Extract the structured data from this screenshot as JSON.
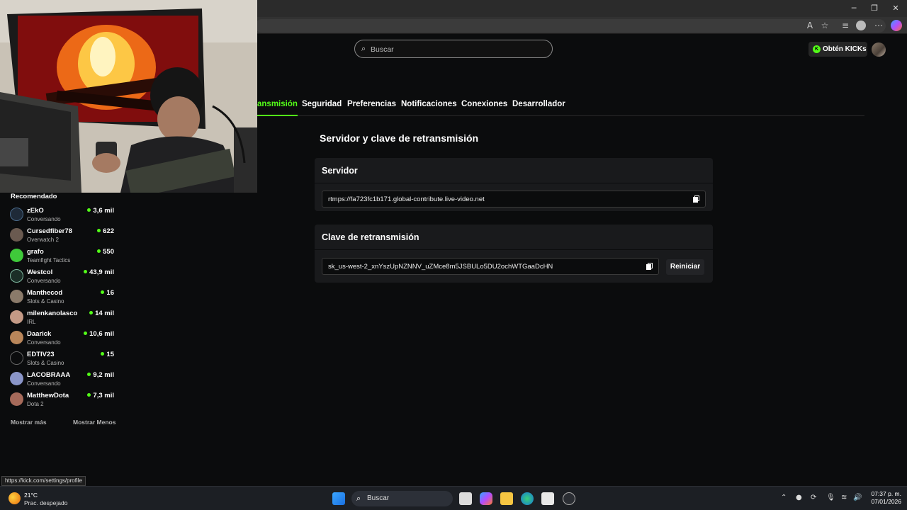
{
  "browser": {
    "minimize": "─",
    "maximize": "❐",
    "close": "✕"
  },
  "header": {
    "search_placeholder": "Buscar",
    "kicks_button": "Obtén KICKs"
  },
  "tabs": [
    {
      "label": "ansmisión",
      "active": true
    },
    {
      "label": "Seguridad"
    },
    {
      "label": "Preferencias"
    },
    {
      "label": "Notificaciones"
    },
    {
      "label": "Conexiones"
    },
    {
      "label": "Desarrollador"
    }
  ],
  "main": {
    "section_title": "Servidor y clave de retransmisión",
    "server_card": {
      "title": "Servidor",
      "value": "rtmps://fa723fc1b171.global-contribute.live-video.net"
    },
    "key_card": {
      "title": "Clave de retransmisión",
      "value": "sk_us-west-2_xnYszUpNZNNV_uZMce8m5JSBULo5DU2ochWTGaaDcHN",
      "reset_label": "Reiniciar"
    }
  },
  "sidebar": {
    "title": "Recomendado",
    "items": [
      {
        "name": "zEkO",
        "category": "Conversando",
        "viewers": "3,6 mil"
      },
      {
        "name": "Cursedfiber78",
        "category": "Overwatch 2",
        "viewers": "622"
      },
      {
        "name": "grafo",
        "category": "Teamfight Tactics",
        "viewers": "550"
      },
      {
        "name": "Westcol",
        "category": "Conversando",
        "viewers": "43,9 mil"
      },
      {
        "name": "Manthecod",
        "category": "Slots & Casino",
        "viewers": "16"
      },
      {
        "name": "milenkanolasco",
        "category": "IRL",
        "viewers": "14 mil"
      },
      {
        "name": "Daarick",
        "category": "Conversando",
        "viewers": "10,6 mil"
      },
      {
        "name": "EDTIV23",
        "category": "Slots & Casino",
        "viewers": "15"
      },
      {
        "name": "LACOBRAAA",
        "category": "Conversando",
        "viewers": "9,2 mil"
      },
      {
        "name": "MatthewDota",
        "category": "Dota 2",
        "viewers": "7,3 mil"
      }
    ],
    "show_more": "Mostrar más",
    "show_less": "Mostrar Menos"
  },
  "status_url": "https://kick.com/settings/profile",
  "taskbar": {
    "temperature": "21°C",
    "weather": "Prac. despejado",
    "search_label": "Buscar",
    "time": "07:37 p. m.",
    "date": "07/01/2026"
  },
  "colors": {
    "accent": "#53fc18",
    "background": "#0b0c0d",
    "card": "#191a1c"
  }
}
